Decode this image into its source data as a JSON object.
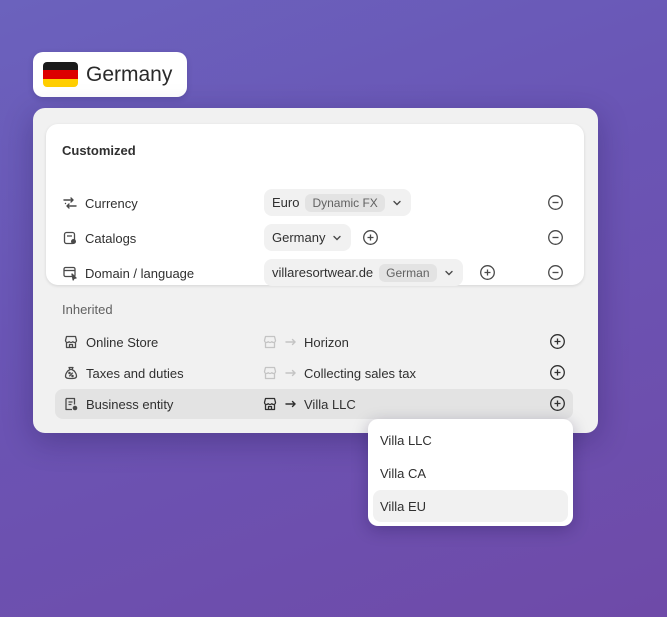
{
  "country": {
    "name": "Germany",
    "flag_colors": [
      "#1a1a1a",
      "#dd0000",
      "#ffce00"
    ]
  },
  "customized": {
    "title": "Customized",
    "rows": [
      {
        "label": "Currency",
        "icon": "currency-exchange-icon",
        "value": "Euro",
        "tag": "Dynamic FX"
      },
      {
        "label": "Catalogs",
        "icon": "catalog-icon",
        "value": "Germany"
      },
      {
        "label": "Domain / language",
        "icon": "domain-icon",
        "value": "villaresortwear.de",
        "tag": "German"
      }
    ]
  },
  "inherited": {
    "title": "Inherited",
    "rows": [
      {
        "label": "Online Store",
        "icon": "store-icon",
        "value": "Horizon"
      },
      {
        "label": "Taxes and duties",
        "icon": "money-bag-icon",
        "value": "Collecting sales tax"
      },
      {
        "label": "Business entity",
        "icon": "document-icon",
        "value": "Villa LLC"
      }
    ]
  },
  "dropdown": {
    "options": [
      "Villa LLC",
      "Villa CA",
      "Villa EU"
    ],
    "selected": "Villa EU"
  }
}
